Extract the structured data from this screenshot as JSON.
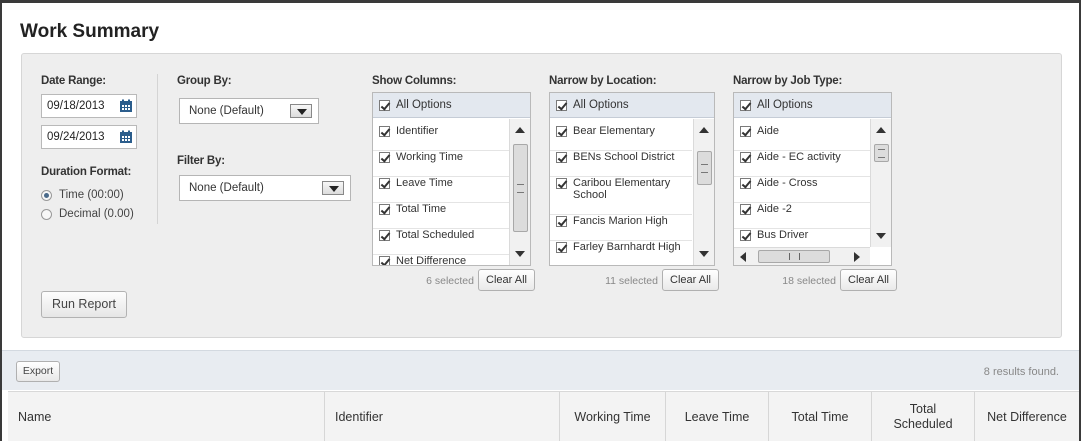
{
  "page": {
    "title": "Work Summary"
  },
  "filters": {
    "date_range": {
      "label": "Date Range:",
      "start": "09/18/2013",
      "end": "09/24/2013"
    },
    "duration_format": {
      "label": "Duration Format:",
      "options": [
        {
          "label": "Time (00:00)",
          "selected": true
        },
        {
          "label": "Decimal (0.00)",
          "selected": false
        }
      ]
    },
    "group_by": {
      "label": "Group By:",
      "value": "None (Default)"
    },
    "filter_by": {
      "label": "Filter By:",
      "value": "None (Default)"
    },
    "show_columns": {
      "label": "Show Columns:",
      "all_label": "All Options",
      "items": [
        "Identifier",
        "Working Time",
        "Leave Time",
        "Total Time",
        "Total Scheduled",
        "Net Difference"
      ],
      "count": "6 selected",
      "clear_label": "Clear All"
    },
    "location": {
      "label": "Narrow by Location:",
      "all_label": "All Options",
      "items": [
        "Bear Elementary",
        "BENs School District",
        "Caribou Elementary School",
        "Fancis Marion High",
        "Farley Barnhardt High"
      ],
      "count": "11 selected",
      "clear_label": "Clear All"
    },
    "job_type": {
      "label": "Narrow by Job Type:",
      "all_label": "All Options",
      "items": [
        "Aide",
        "Aide - EC activity",
        "Aide - Cross",
        "Aide -2",
        "Bus Driver"
      ],
      "count": "18 selected",
      "clear_label": "Clear All"
    },
    "run_label": "Run Report"
  },
  "results": {
    "export_label": "Export",
    "count_text": "8 results found.",
    "columns": [
      "Name",
      "Identifier",
      "Working Time",
      "Leave Time",
      "Total Time",
      "Total Scheduled",
      "Net Difference"
    ]
  },
  "colors": {
    "calendar_icon": "#2b5d8c",
    "panel_bg": "#eeeeee",
    "listbox_header": "#e3e8ef"
  }
}
